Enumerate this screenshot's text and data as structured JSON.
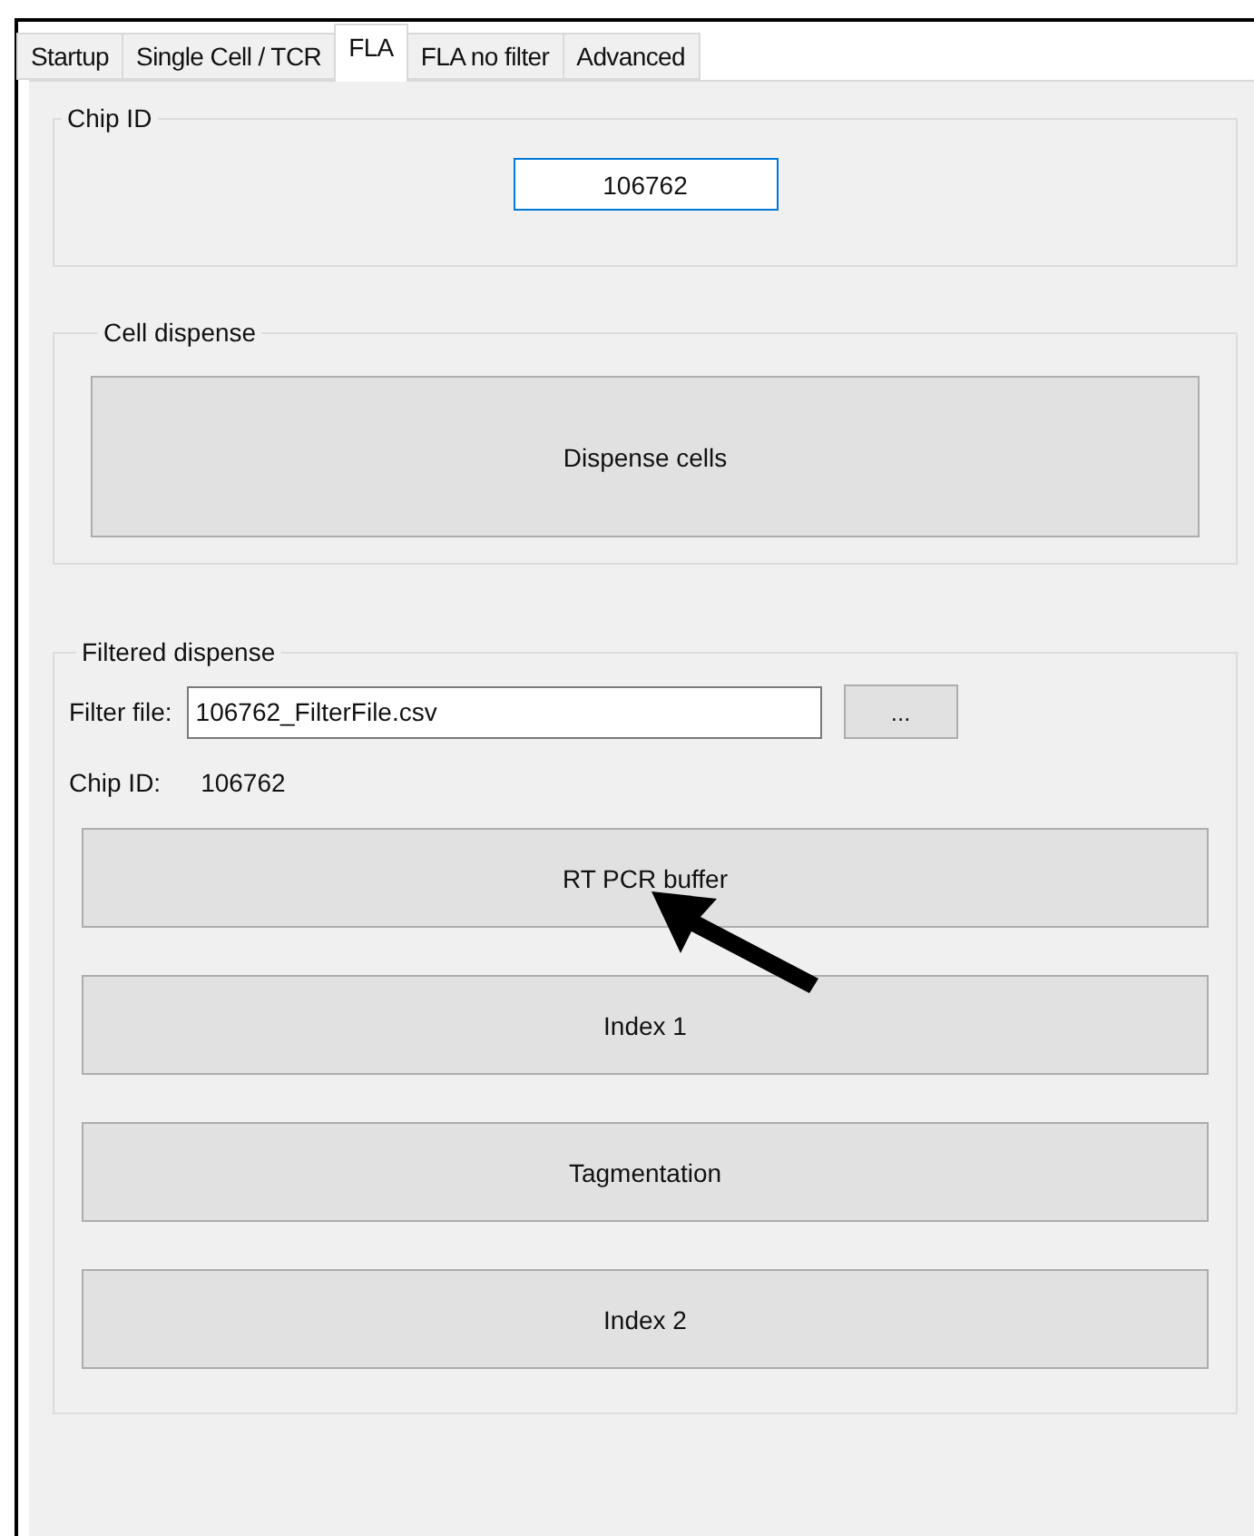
{
  "tabs": [
    {
      "label": "Startup",
      "selected": false
    },
    {
      "label": "Single Cell / TCR",
      "selected": false
    },
    {
      "label": "FLA",
      "selected": true
    },
    {
      "label": "FLA no filter",
      "selected": false
    },
    {
      "label": "Advanced",
      "selected": false
    }
  ],
  "chip_id_group": {
    "title": "Chip ID",
    "value": "106762"
  },
  "cell_dispense_group": {
    "title": "Cell dispense",
    "button": "Dispense cells"
  },
  "filtered_dispense_group": {
    "title": "Filtered dispense",
    "filter_file_label": "Filter file:",
    "filter_file_value": "106762_FilterFile.csv",
    "browse_button": "...",
    "chip_id_label": "Chip ID:",
    "chip_id_value": "106762",
    "buttons": [
      "RT PCR buffer",
      "Index 1",
      "Tagmentation",
      "Index 2"
    ]
  }
}
